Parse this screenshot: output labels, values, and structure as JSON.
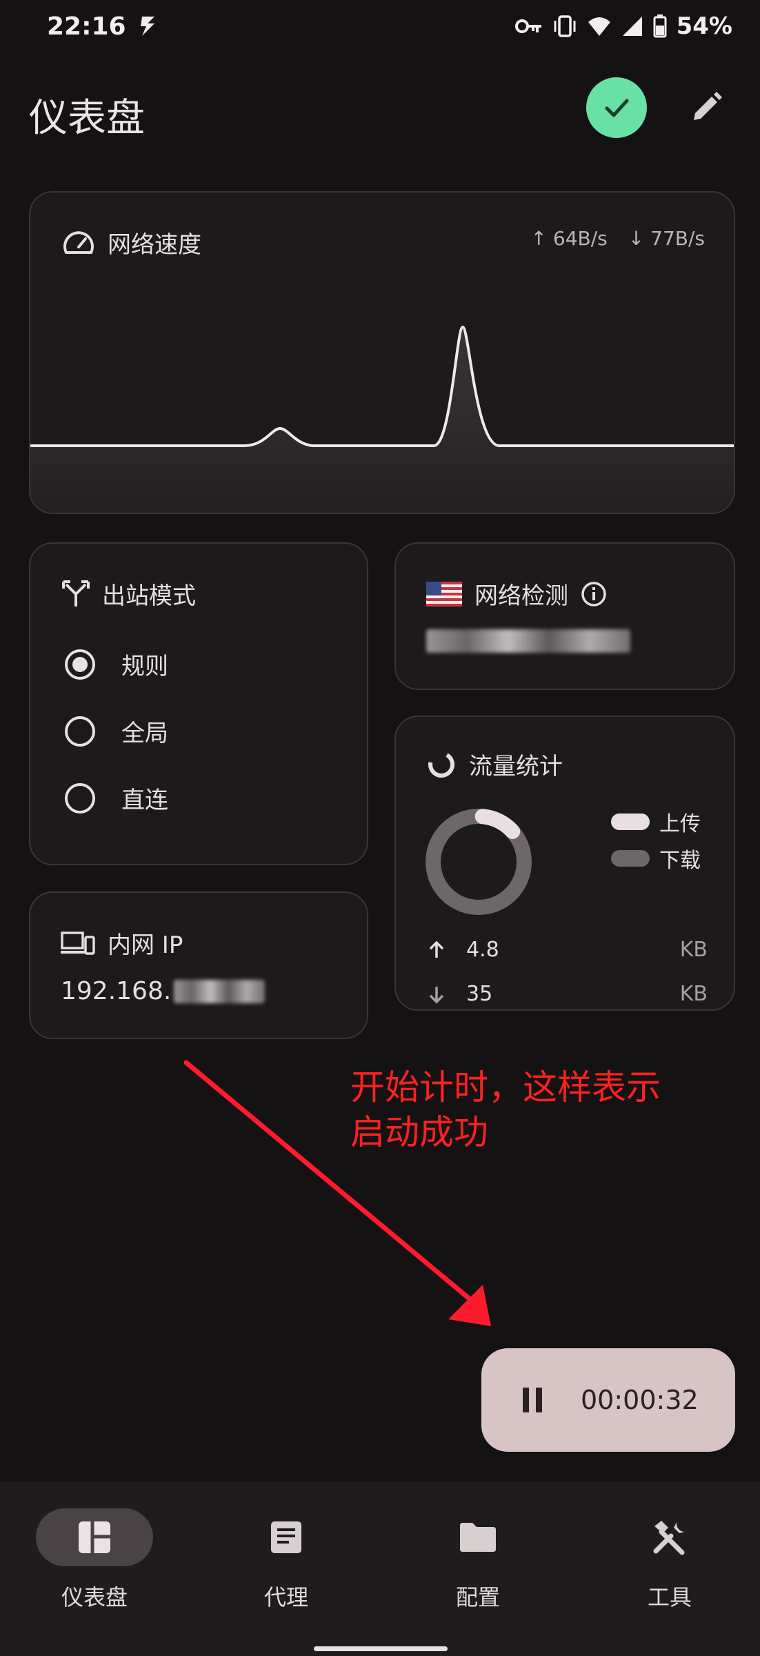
{
  "status_bar": {
    "time": "22:16",
    "battery": "54%"
  },
  "header": {
    "title": "仪表盘"
  },
  "speed": {
    "title": "网络速度",
    "up": "↑ 64B/s",
    "down": "↓ 77B/s"
  },
  "mode": {
    "title": "出站模式",
    "options": [
      "规则",
      "全局",
      "直连"
    ],
    "selected": "规则"
  },
  "netcheck": {
    "title": "网络检测"
  },
  "traffic": {
    "title": "流量统计",
    "legend_up": "上传",
    "legend_down": "下载",
    "up_value": "4.8",
    "up_unit": "KB",
    "down_value": "35",
    "down_unit": "KB",
    "upload_fraction": 0.12
  },
  "ip": {
    "title": "内网 IP",
    "value": "192.168."
  },
  "annotation": {
    "line1": "开始计时，这样表示",
    "line2": "启动成功"
  },
  "timer": {
    "value": "00:00:32"
  },
  "nav": {
    "items": [
      "仪表盘",
      "代理",
      "配置",
      "工具"
    ],
    "active": "仪表盘"
  },
  "colors": {
    "accent_green": "#69e0a4",
    "timer_bg": "#d8c4c5",
    "annotation_red": "#ff2020"
  }
}
